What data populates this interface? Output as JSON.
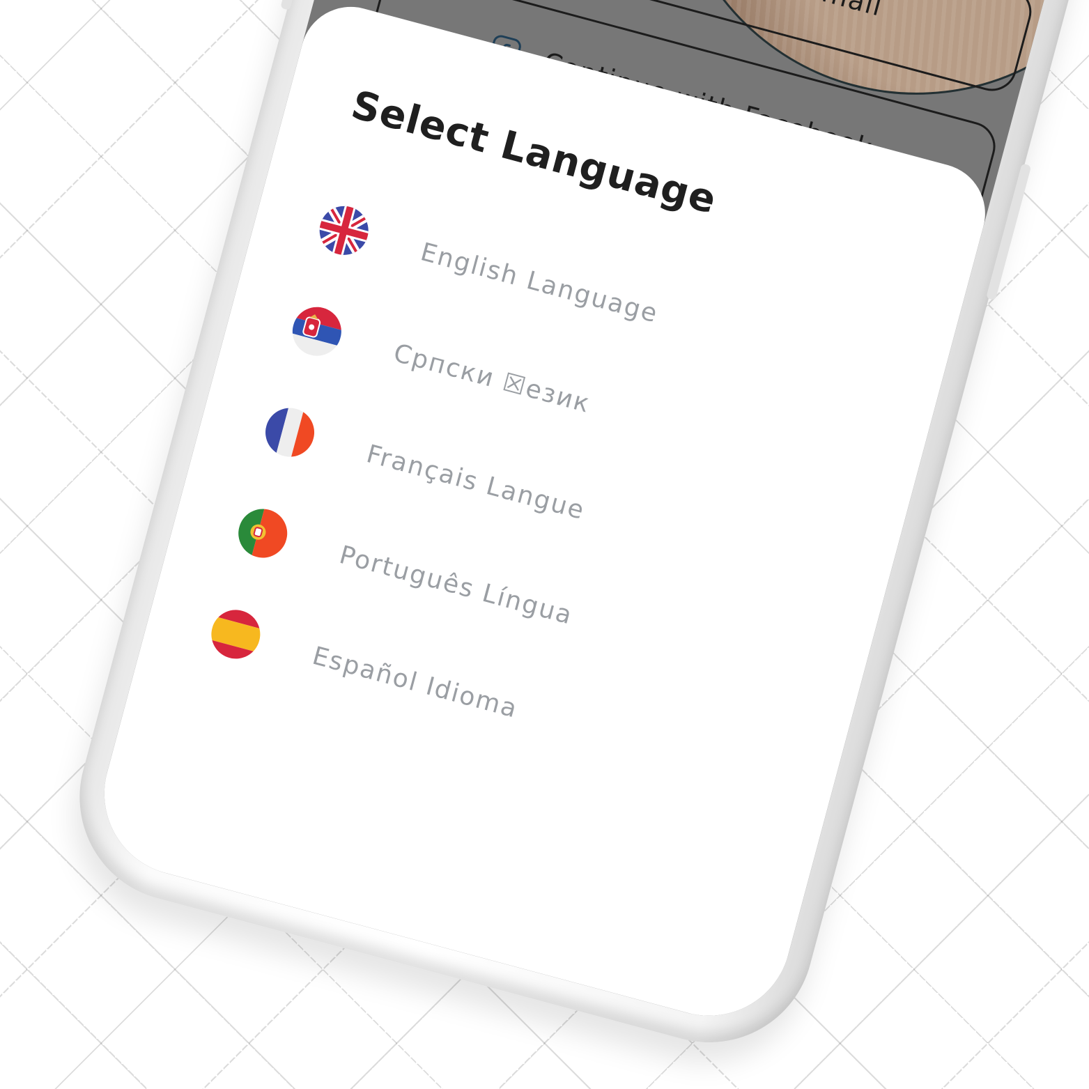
{
  "auth": {
    "email_label": "Continue with Email",
    "facebook_label": "Continue with Facebook"
  },
  "sheet": {
    "title": "Select Language"
  },
  "languages": [
    {
      "label": "English Language",
      "flag": "uk-flag-icon"
    },
    {
      "label": "Српски ☒език",
      "flag": "serbia-flag-icon"
    },
    {
      "label": "Français Langue",
      "flag": "france-flag-icon"
    },
    {
      "label": "Português Língua",
      "flag": "portugal-flag-icon"
    },
    {
      "label": "Español Idioma",
      "flag": "spain-flag-icon"
    }
  ],
  "colors": {
    "screen_dim": "#777777",
    "sheet_bg": "#ffffff",
    "icon_blue": "#1f3f57",
    "label_gray": "#9a9ea3"
  }
}
